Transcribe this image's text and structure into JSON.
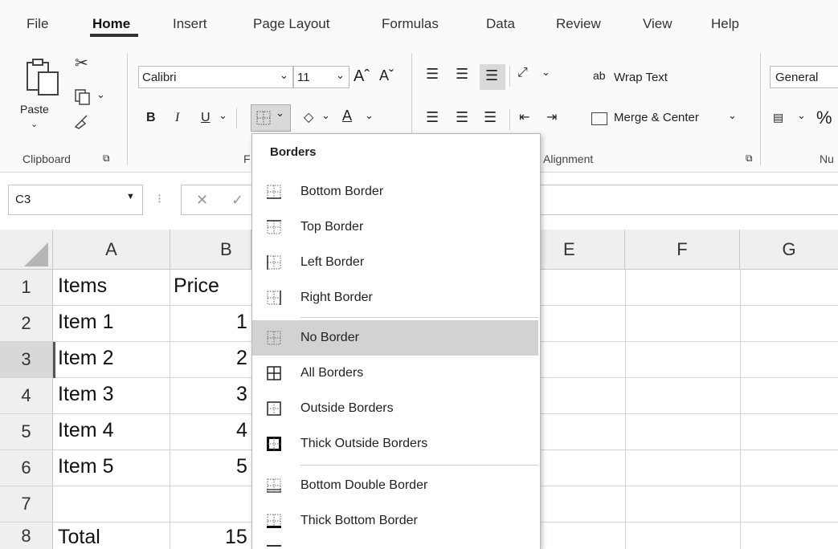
{
  "tabs": [
    {
      "label": "File"
    },
    {
      "label": "Home"
    },
    {
      "label": "Insert"
    },
    {
      "label": "Page Layout"
    },
    {
      "label": "Formulas"
    },
    {
      "label": "Data"
    },
    {
      "label": "Review"
    },
    {
      "label": "View"
    },
    {
      "label": "Help"
    }
  ],
  "active_tab": "Home",
  "ribbon": {
    "clipboard": {
      "paste_label": "Paste",
      "group_label": "Clipboard"
    },
    "font": {
      "font_name": "Calibri",
      "font_size": "11",
      "grow_glyph": "Aˆ",
      "shrink_glyph": "Aˇ",
      "bold": "B",
      "italic": "I",
      "underline": "U",
      "group_label": "F"
    },
    "alignment": {
      "wrap_text": "Wrap Text",
      "merge_center": "Merge & Center",
      "group_label": "Alignment"
    },
    "number": {
      "format": "General",
      "percent": "%",
      "group_label": "Nu"
    }
  },
  "formula_bar": {
    "name_box": "C3",
    "cancel_glyph": "✕",
    "enter_glyph": "✓"
  },
  "sheet": {
    "columns": [
      "A",
      "B",
      "E",
      "F",
      "G"
    ],
    "rows": [
      "1",
      "2",
      "3",
      "4",
      "5",
      "6",
      "7",
      "8"
    ],
    "selected_row": "3",
    "col_a": [
      "Items",
      "Item 1",
      "Item 2",
      "Item 3",
      "Item 4",
      "Item 5",
      "",
      "Total"
    ],
    "col_b": [
      "Price",
      "1",
      "2",
      "3",
      "4",
      "5",
      "",
      "15"
    ]
  },
  "borders_menu": {
    "title": "Borders",
    "items": [
      {
        "label": "Bottom Border",
        "icon": "bottom-border-icon"
      },
      {
        "label": "Top Border",
        "icon": "top-border-icon"
      },
      {
        "label": "Left Border",
        "icon": "left-border-icon"
      },
      {
        "label": "Right Border",
        "icon": "right-border-icon"
      },
      {
        "label": "No Border",
        "icon": "no-border-icon"
      },
      {
        "label": "All Borders",
        "icon": "all-borders-icon"
      },
      {
        "label": "Outside Borders",
        "icon": "outside-borders-icon"
      },
      {
        "label": "Thick Outside Borders",
        "icon": "thick-outside-borders-icon"
      },
      {
        "label": "Bottom Double Border",
        "icon": "bottom-double-border-icon"
      },
      {
        "label": "Thick Bottom Border",
        "icon": "thick-bottom-border-icon"
      }
    ],
    "highlighted": "No Border"
  },
  "colors": {
    "ribbon_bg": "#fafafa",
    "header_bg": "#efefef",
    "highlight": "#d2d2d2",
    "grid": "#d4d4d4"
  }
}
